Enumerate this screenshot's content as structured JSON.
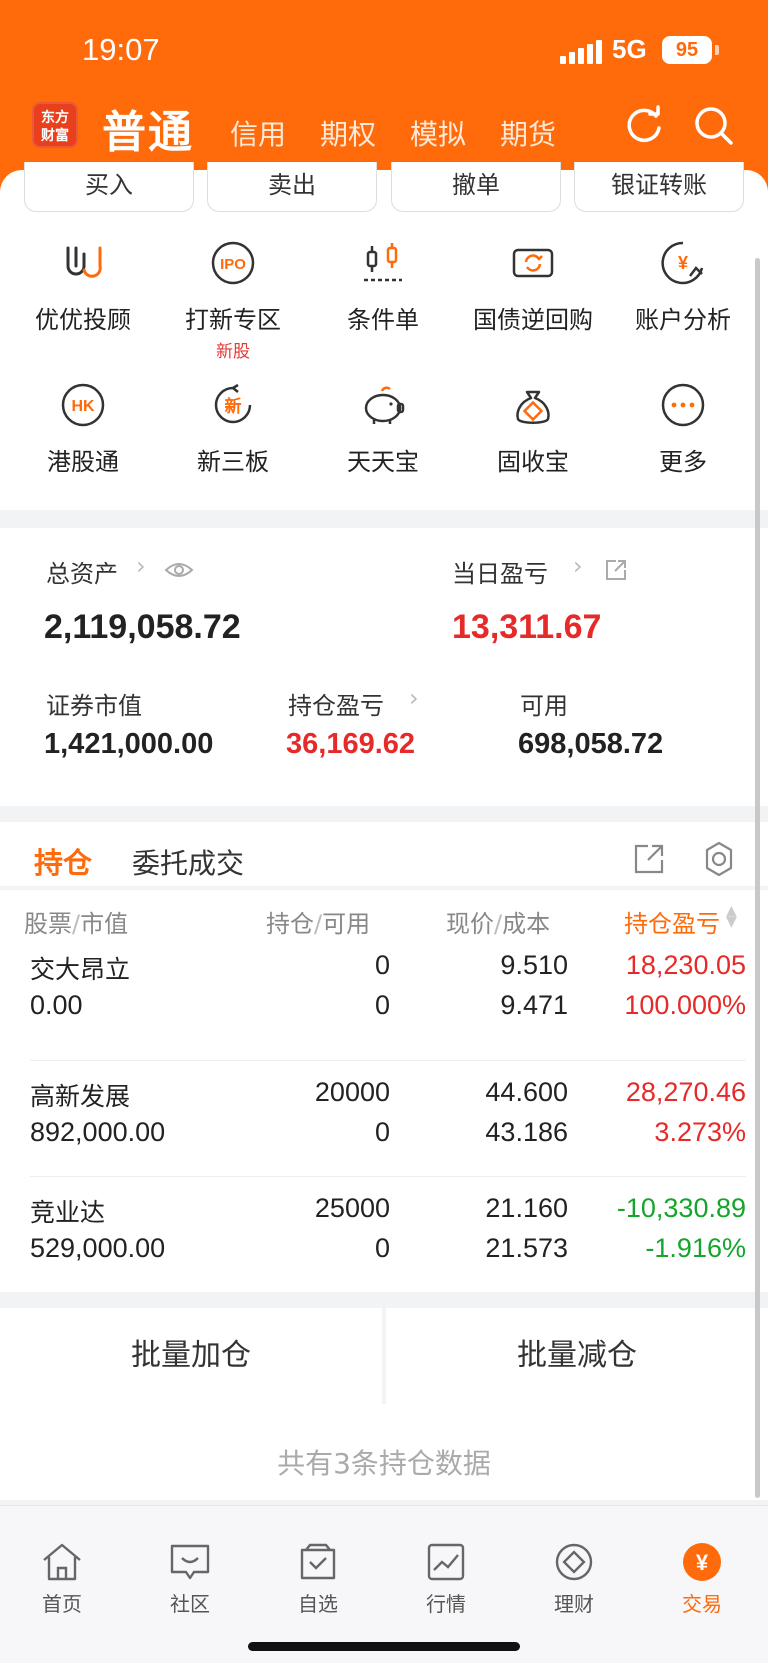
{
  "status": {
    "time": "19:07",
    "network": "5G",
    "battery": "95"
  },
  "nav": {
    "logo_line1": "东方",
    "logo_line2": "财富",
    "active": "普通",
    "tabs": [
      "信用",
      "期权",
      "模拟",
      "期货"
    ]
  },
  "quick_actions": [
    "买入",
    "卖出",
    "撤单",
    "银证转账"
  ],
  "features": [
    {
      "label": "优优投顾",
      "icon": "uu-advisor-icon"
    },
    {
      "label": "打新专区",
      "tag": "新股",
      "icon": "ipo-icon"
    },
    {
      "label": "条件单",
      "icon": "conditional-order-icon"
    },
    {
      "label": "国债逆回购",
      "icon": "bond-repo-icon"
    },
    {
      "label": "账户分析",
      "icon": "account-analysis-icon"
    },
    {
      "label": "港股通",
      "icon": "hk-connect-icon"
    },
    {
      "label": "新三板",
      "icon": "new-third-board-icon"
    },
    {
      "label": "天天宝",
      "icon": "piggy-bank-icon"
    },
    {
      "label": "固收宝",
      "icon": "money-bag-icon"
    },
    {
      "label": "更多",
      "icon": "more-icon"
    }
  ],
  "assets": {
    "total_label": "总资产",
    "total_value": "2,119,058.72",
    "daily_pl_label": "当日盈亏",
    "daily_pl_value": "13,311.67",
    "market_value_label": "证券市值",
    "market_value": "1,421,000.00",
    "position_pl_label": "持仓盈亏",
    "position_pl_value": "36,169.62",
    "available_label": "可用",
    "available_value": "698,058.72"
  },
  "holdings": {
    "tab_active": "持仓",
    "tab_other": "委托成交",
    "headers": {
      "stock_a": "股票",
      "stock_b": "市值",
      "pos_a": "持仓",
      "pos_b": "可用",
      "price_a": "现价",
      "price_b": "成本",
      "pl": "持仓盈亏"
    },
    "rows": [
      {
        "name": "交大昂立",
        "market_value": "0.00",
        "position": "0",
        "available": "0",
        "price": "9.510",
        "cost": "9.471",
        "pl": "18,230.05",
        "pl_pct": "100.000%",
        "trend": "up"
      },
      {
        "name": "高新发展",
        "market_value": "892,000.00",
        "position": "20000",
        "available": "0",
        "price": "44.600",
        "cost": "43.186",
        "pl": "28,270.46",
        "pl_pct": "3.273%",
        "trend": "up"
      },
      {
        "name": "竞业达",
        "market_value": "529,000.00",
        "position": "25000",
        "available": "0",
        "price": "21.160",
        "cost": "21.573",
        "pl": "-10,330.89",
        "pl_pct": "-1.916%",
        "trend": "down"
      }
    ]
  },
  "batch": {
    "add": "批量加仓",
    "reduce": "批量减仓"
  },
  "summary": "共有3条持仓数据",
  "tabbar": [
    {
      "label": "首页",
      "icon": "home-icon"
    },
    {
      "label": "社区",
      "icon": "community-icon"
    },
    {
      "label": "自选",
      "icon": "watchlist-icon"
    },
    {
      "label": "行情",
      "icon": "market-icon"
    },
    {
      "label": "理财",
      "icon": "wealth-icon"
    },
    {
      "label": "交易",
      "icon": "trade-icon"
    }
  ],
  "colors": {
    "brand": "#ff6a0a",
    "up": "#e62a2a",
    "down": "#16a52c"
  }
}
